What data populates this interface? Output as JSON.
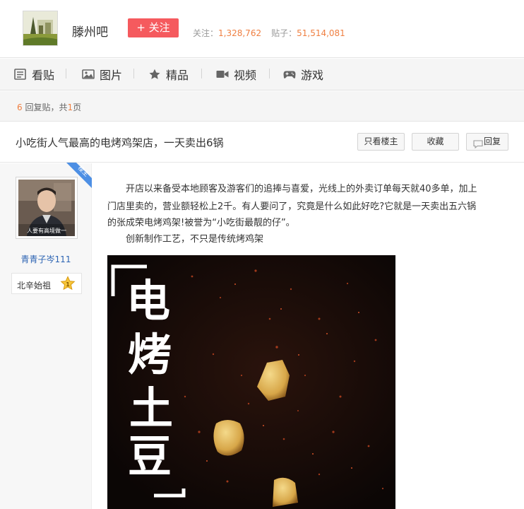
{
  "forum": {
    "name": "滕州吧",
    "follow_label": "+ 关注",
    "stats": {
      "followers_label": "关注：",
      "followers": "1,328,762",
      "posts_label": "贴子：",
      "posts": "51,514,081"
    }
  },
  "tabs": [
    {
      "label": "看贴",
      "icon": "posts-icon"
    },
    {
      "label": "图片",
      "icon": "image-icon"
    },
    {
      "label": "精品",
      "icon": "star-icon"
    },
    {
      "label": "视频",
      "icon": "video-icon"
    },
    {
      "label": "游戏",
      "icon": "gamepad-icon"
    }
  ],
  "reply_info": {
    "count": "6",
    "suffix": " 回复贴，共",
    "pages": "1",
    "page_suffix": "页"
  },
  "thread": {
    "title": "小吃街人气最高的电烤鸡架店，一天卖出6锅",
    "buttons": {
      "only_op": "只看楼主",
      "favorite": "收藏",
      "reply": "回复"
    }
  },
  "author": {
    "name": "青青子岑111",
    "avatar_caption": "人要有高境做一",
    "level_name": "北辛始祖",
    "level": "1",
    "corner_tag": "楼主"
  },
  "post": {
    "paragraph_1_line_1": "开店以来备受本地顾客及游客们的追捧与喜爱，光线上的外卖订单每天就40多单，加上",
    "paragraph_1_line_2": "门店里卖的，营业额轻松上2千。有人要问了，究竟是什么如此好吃?它就是一天卖出五六锅",
    "paragraph_1_line_3": "的张成荣电烤鸡架!被誉为“小吃街最靓的仔”。",
    "paragraph_2": "创新制作工艺，不只是传统烤鸡架",
    "image_text": [
      "电",
      "烤",
      "土",
      "豆"
    ]
  },
  "colors": {
    "follow_bg": "#f55a5e",
    "stat_number": "#ef7f41",
    "author_link": "#2d64b3",
    "tag_blue": "#4d8fe4"
  }
}
